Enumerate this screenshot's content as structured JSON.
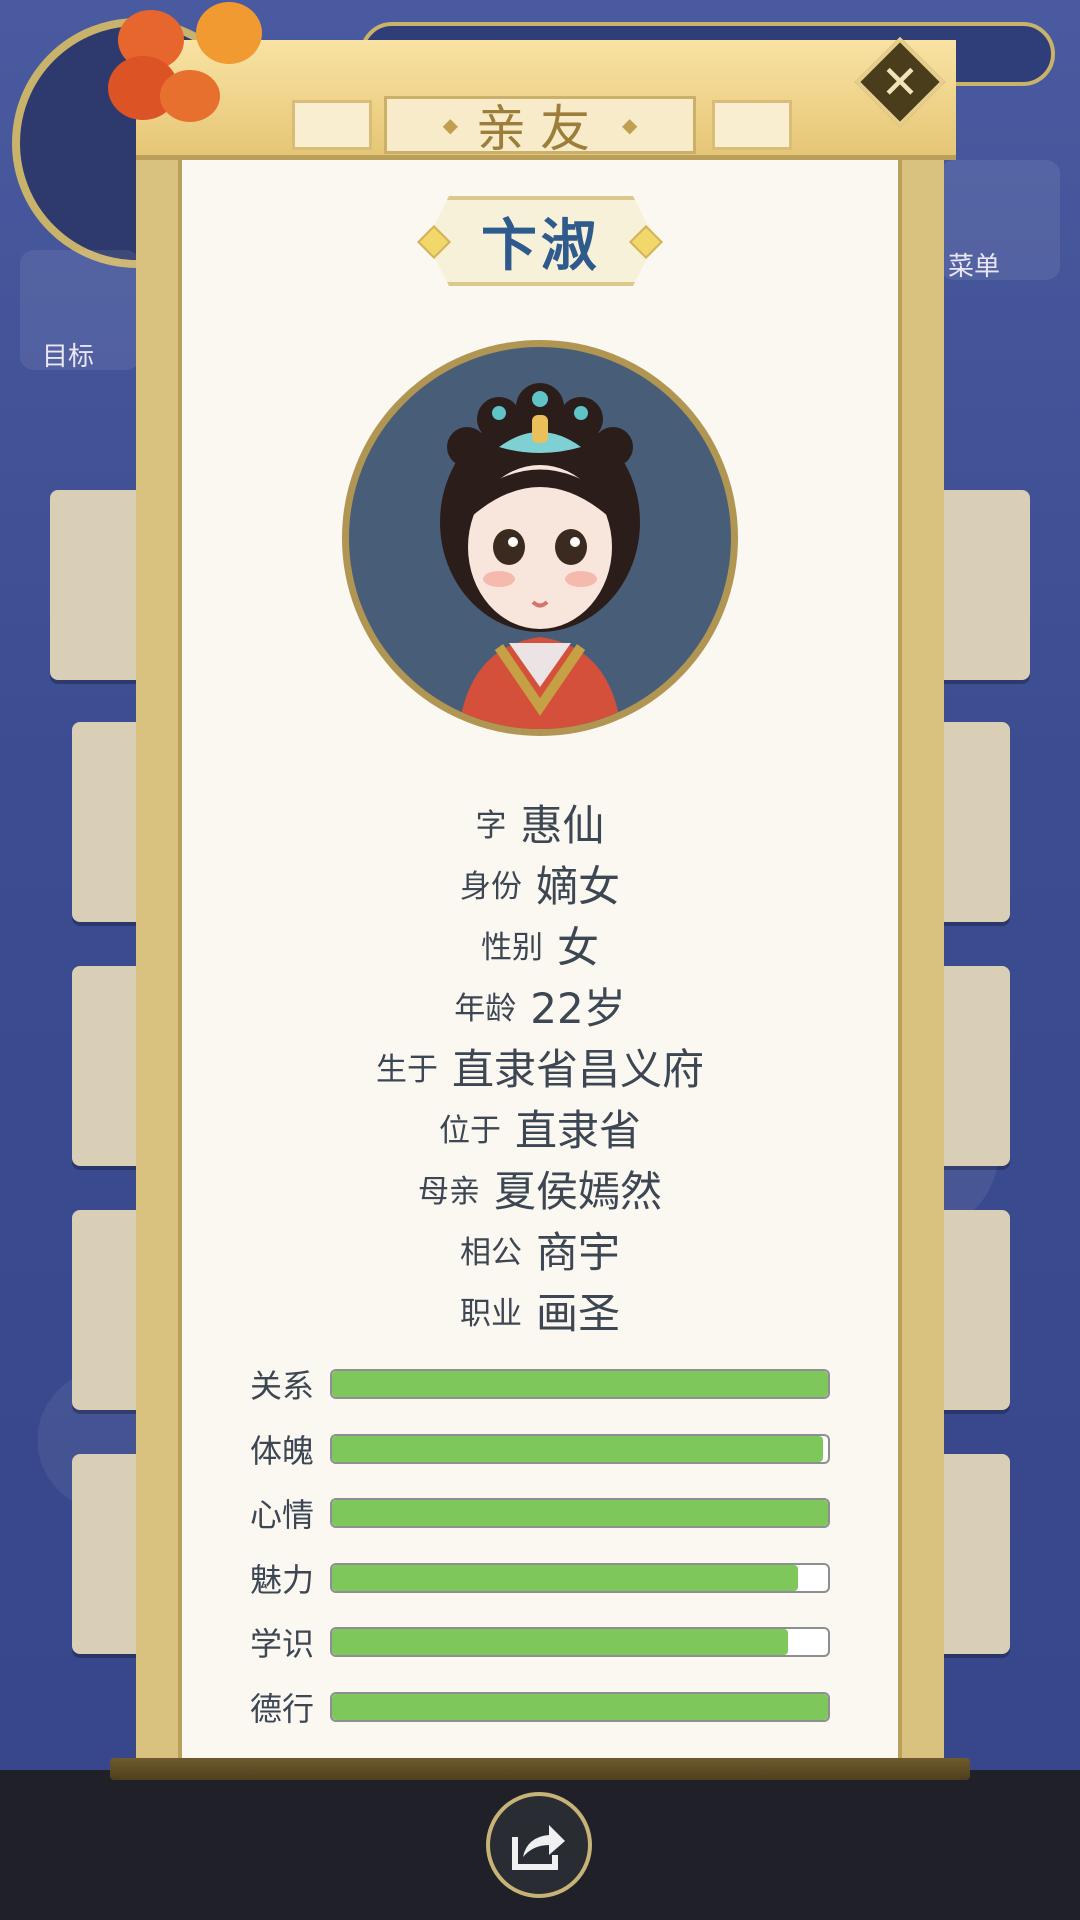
{
  "background": {
    "hud_target_label": "目标",
    "hud_menu_label": "菜单"
  },
  "dialog": {
    "title": "亲友",
    "name": "卞淑",
    "fields": [
      {
        "label": "字",
        "value": "惠仙"
      },
      {
        "label": "身份",
        "value": "嫡女"
      },
      {
        "label": "性别",
        "value": "女"
      },
      {
        "label": "年龄",
        "value": "22岁"
      },
      {
        "label": "生于",
        "value": "直隶省昌义府"
      },
      {
        "label": "位于",
        "value": "直隶省"
      },
      {
        "label": "母亲",
        "value": "夏侯嫣然"
      },
      {
        "label": "相公",
        "value": "商宇"
      },
      {
        "label": "职业",
        "value": "画圣"
      }
    ],
    "stats": [
      {
        "label": "关系",
        "percent": 100
      },
      {
        "label": "体魄",
        "percent": 99
      },
      {
        "label": "心情",
        "percent": 100
      },
      {
        "label": "魅力",
        "percent": 94
      },
      {
        "label": "学识",
        "percent": 92
      },
      {
        "label": "德行",
        "percent": 100
      }
    ]
  },
  "colors": {
    "stat_fill": "#7ec75a",
    "name_text": "#2f5a8c",
    "title_text": "#9c7d3a"
  },
  "icons": {
    "close": "close-x-icon",
    "share": "share-icon"
  }
}
